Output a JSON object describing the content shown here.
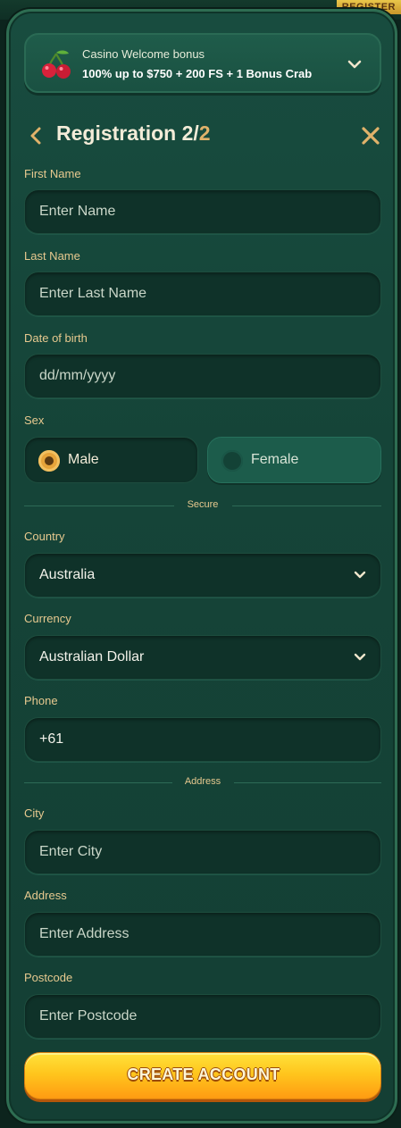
{
  "background": {
    "register_label": "REGISTER"
  },
  "bonus": {
    "icon": "cherry-icon",
    "title": "Casino Welcome bonus",
    "description": "100% up to $750 + 200 FS + 1 Bonus Crab"
  },
  "header": {
    "title": "Registration 2/",
    "title_step": "2"
  },
  "fields": {
    "first_name": {
      "label": "First Name",
      "placeholder": "Enter Name"
    },
    "last_name": {
      "label": "Last Name",
      "placeholder": "Enter Last Name"
    },
    "dob": {
      "label": "Date of birth",
      "placeholder": "dd/mm/yyyy"
    },
    "sex": {
      "label": "Sex",
      "options": [
        "Male",
        "Female"
      ],
      "selected": "Male"
    },
    "secure_divider": "Secure",
    "country": {
      "label": "Country",
      "value": "Australia"
    },
    "currency": {
      "label": "Currency",
      "value": "Australian Dollar"
    },
    "phone": {
      "label": "Phone",
      "value": "+61"
    },
    "address_divider": "Address",
    "city": {
      "label": "City",
      "placeholder": "Enter City"
    },
    "address": {
      "label": "Address",
      "placeholder": "Enter Address"
    },
    "postcode": {
      "label": "Postcode",
      "placeholder": "Enter Postcode"
    }
  },
  "actions": {
    "create_account": "CREATE ACCOUNT"
  },
  "colors": {
    "panel": "#154438",
    "accent_gold": "#e0b26a",
    "label": "#e7c98f",
    "button_top": "#ffe23b",
    "button_bottom": "#ff9b12"
  }
}
